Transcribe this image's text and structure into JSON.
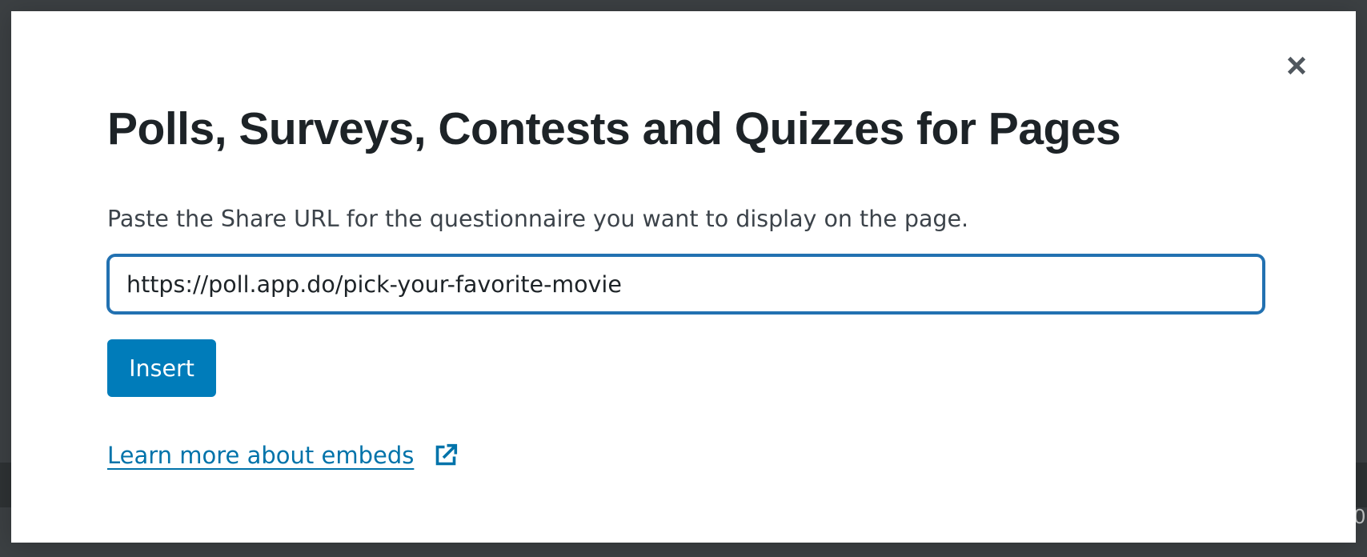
{
  "backdrop": {
    "edge_glyph": "0"
  },
  "modal": {
    "title": "Polls, Surveys, Contests and Quizzes for Pages",
    "description": "Paste the Share URL for the questionnaire you want to display on the page.",
    "url_input": {
      "value": "https://poll.app.do/pick-your-favorite-movie"
    },
    "insert_label": "Insert",
    "learn_more_label": "Learn more about embeds",
    "icons": {
      "close": "close-icon",
      "external_link": "external-link-icon"
    }
  },
  "colors": {
    "primary": "#007cba",
    "link": "#0073aa",
    "input_border": "#2271b1",
    "title_text": "#1d2327",
    "body_text": "#3c434a",
    "backdrop": "#3c4043"
  }
}
